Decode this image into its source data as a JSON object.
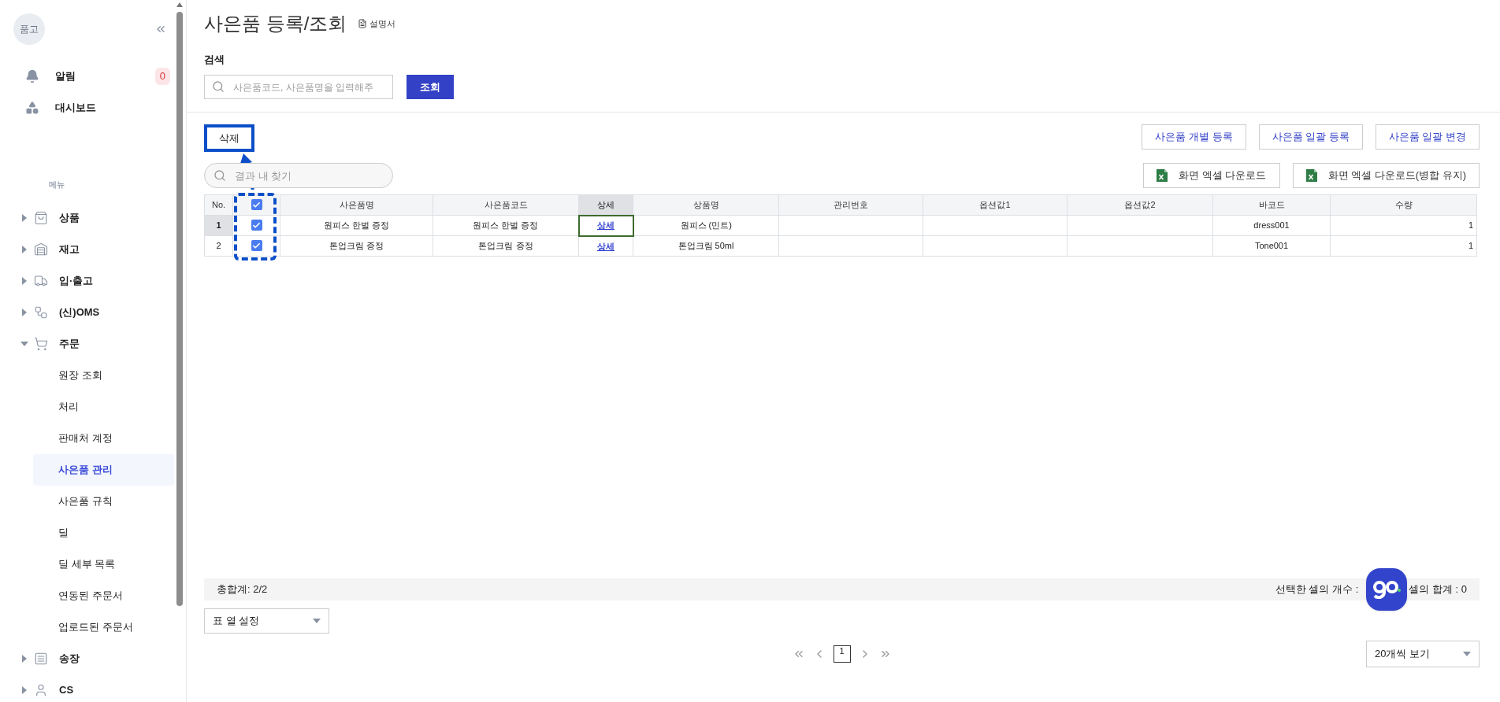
{
  "sidebar": {
    "avatar": "품고",
    "top_items": [
      {
        "label": "알림",
        "badge": "0"
      },
      {
        "label": "대시보드"
      }
    ],
    "menu_heading": "메뉴",
    "menu": [
      {
        "label": "상품",
        "expanded": false
      },
      {
        "label": "재고",
        "expanded": false
      },
      {
        "label": "입·출고",
        "expanded": false
      },
      {
        "label": "(신)OMS",
        "expanded": false
      },
      {
        "label": "주문",
        "expanded": true,
        "children": [
          {
            "label": "원장 조회",
            "selected": false
          },
          {
            "label": "처리",
            "selected": false
          },
          {
            "label": "판매처 계정",
            "selected": false
          },
          {
            "label": "사은품 관리",
            "selected": true
          },
          {
            "label": "사은품 규칙",
            "selected": false
          },
          {
            "label": "딜",
            "selected": false
          },
          {
            "label": "딜 세부 목록",
            "selected": false
          },
          {
            "label": "연동된 주문서",
            "selected": false
          },
          {
            "label": "업로드된 주문서",
            "selected": false
          }
        ]
      },
      {
        "label": "송장",
        "expanded": false
      },
      {
        "label": "CS",
        "expanded": false
      }
    ]
  },
  "page": {
    "title": "사은품 등록/조회",
    "manual_link": "설명서"
  },
  "search": {
    "label": "검색",
    "placeholder": "사은품코드, 사은품명을 입력해주",
    "button": "조회"
  },
  "toolbar": {
    "delete_button": "삭제",
    "filter_placeholder": "결과 내 찾기",
    "register_buttons": [
      "사은품 개별 등록",
      "사은품 일괄 등록",
      "사은품 일괄 변경"
    ],
    "excel_buttons": [
      "화면 엑셀 다운로드",
      "화면 엑셀 다운로드(병합 유지)"
    ]
  },
  "table": {
    "select_all_checked": true,
    "columns": [
      {
        "label": "No.",
        "selected": false
      },
      {
        "label": "사은품명",
        "selected": false
      },
      {
        "label": "사은품코드",
        "selected": false
      },
      {
        "label": "상세",
        "selected": true
      },
      {
        "label": "상품명",
        "selected": false
      },
      {
        "label": "관리번호",
        "selected": false
      },
      {
        "label": "옵션값1",
        "selected": false
      },
      {
        "label": "옵션값2",
        "selected": false
      },
      {
        "label": "바코드",
        "selected": false
      },
      {
        "label": "수량",
        "selected": false
      }
    ],
    "rows": [
      {
        "no": "1",
        "checked": true,
        "selected": true,
        "gift_name": "원피스 한벌 증정",
        "gift_code": "원피스 한벌 증정",
        "detail": "상세",
        "product": "원피스 (민트)",
        "barcode": "dress001",
        "quantity": "1"
      },
      {
        "no": "2",
        "checked": true,
        "selected": false,
        "gift_name": "톤업크림 증정",
        "gift_code": "톤업크림 증정",
        "detail": "상세",
        "product": "톤업크림 50ml",
        "barcode": "Tone001",
        "quantity": "1"
      }
    ]
  },
  "summary": {
    "total": "총합계: 2/2",
    "selected_count": "선택한 셀의 개수 :",
    "selected_sum": "셀의 합계 : 0"
  },
  "column_settings": "표 열 설정",
  "pagination": {
    "pages": [
      {
        "label": "1",
        "selected": true
      }
    ]
  },
  "page_size": "20개씩 보기"
}
